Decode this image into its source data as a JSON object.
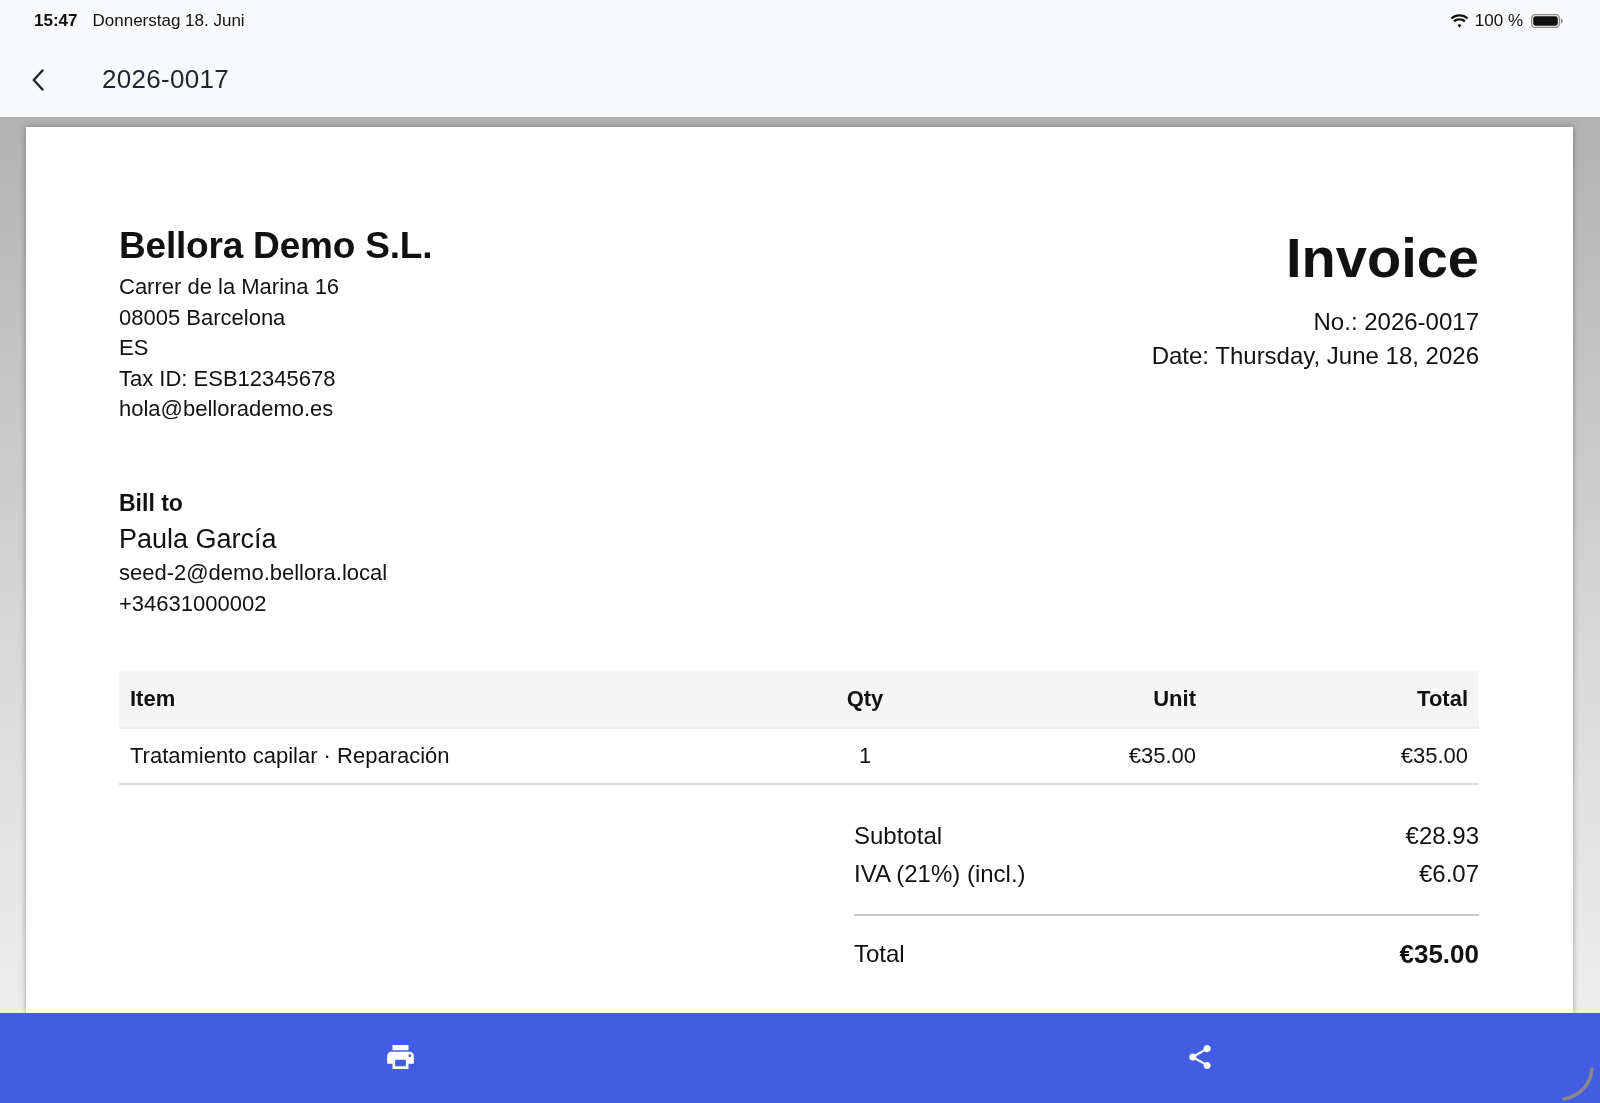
{
  "status_bar": {
    "time": "15:47",
    "date": "Donnerstag 18. Juni",
    "battery": "100 %"
  },
  "header": {
    "title": "2026-0017"
  },
  "invoice": {
    "seller": {
      "name": "Bellora Demo S.L.",
      "lines": [
        "Carrer de la Marina 16",
        "08005 Barcelona",
        "ES",
        "Tax ID: ESB12345678",
        "hola@bellorademo.es"
      ]
    },
    "title": "Invoice",
    "number": "No.: 2026-0017",
    "date": "Date: Thursday, June 18, 2026",
    "bill_to": {
      "label": "Bill to",
      "name": "Paula García",
      "lines": [
        "seed-2@demo.bellora.local",
        "+34631000002"
      ]
    },
    "table": {
      "columns": [
        "Item",
        "Qty",
        "Unit",
        "Total"
      ],
      "rows": [
        [
          "Tratamiento capilar · Reparación",
          "1",
          "€35.00",
          "€35.00"
        ]
      ]
    },
    "totals": [
      {
        "kind": "line",
        "label": "Subtotal",
        "value": "€28.93"
      },
      {
        "kind": "line",
        "label": "IVA (21%) (incl.)",
        "value": "€6.07"
      },
      {
        "kind": "grand",
        "label": "Total",
        "value": "€35.00"
      }
    ]
  }
}
